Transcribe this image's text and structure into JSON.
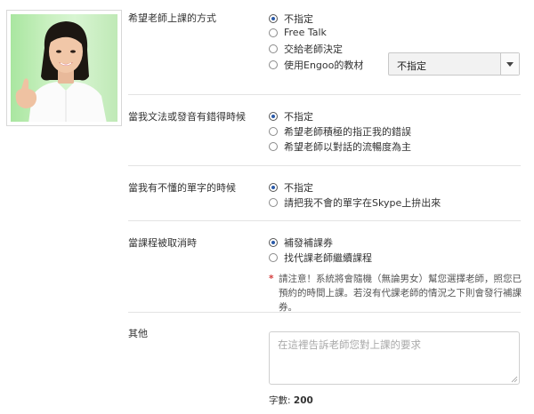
{
  "photo": {
    "alt": "teacher-photo"
  },
  "lesson_style": {
    "label": "希望老師上課的方式",
    "options": [
      "不指定",
      "Free Talk",
      "交給老師決定",
      "使用Engoo的教材"
    ],
    "selected_index": 0,
    "material_select": {
      "value": "不指定"
    }
  },
  "grammar_errors": {
    "label": "當我文法或發音有錯得時候",
    "options": [
      "不指定",
      "希望老師積極的指正我的錯誤",
      "希望老師以對話的流暢度為主"
    ],
    "selected_index": 0
  },
  "unknown_words": {
    "label": "當我有不懂的單字的時候",
    "options": [
      "不指定",
      "請把我不會的單字在Skype上拚出來"
    ],
    "selected_index": 0
  },
  "cancellation": {
    "label": "當課程被取消時",
    "options": [
      "補發補課券",
      "找代課老師繼續課程"
    ],
    "selected_index": 0,
    "note_star": "*",
    "note": "請注意！系統將會隨機（無論男女）幫您選擇老師，照您已預約的時間上課。若沒有代課老師的情況之下則會發行補課券。"
  },
  "other": {
    "label": "其他",
    "placeholder": "在這裡告訴老師您對上課的要求",
    "count_label": "字數:",
    "count_value": "200"
  }
}
